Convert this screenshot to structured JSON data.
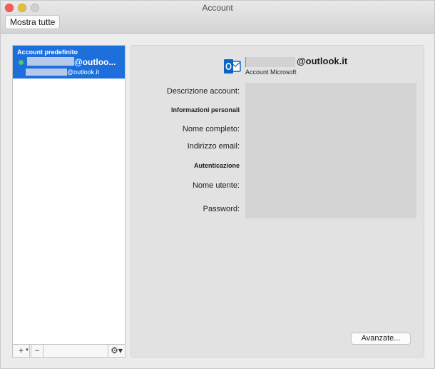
{
  "window": {
    "title": "Account"
  },
  "toolbar": {
    "show_all_label": "Mostra tutte"
  },
  "sidebar": {
    "group_label": "Account predefinito",
    "account_name": "@outloo...",
    "account_email": "@outlook.it",
    "status_color": "#4cc870",
    "selected_color": "#1d6fdc",
    "add_icon": "plus-icon",
    "remove_icon": "minus-icon",
    "actions_icon": "gear-icon",
    "add_glyph": "+",
    "add_chevron_glyph": "▾",
    "remove_glyph": "−",
    "actions_glyph": "⚙▾"
  },
  "detail": {
    "account_email": "@outlook.it",
    "account_type": "Account Microsoft",
    "fields": [
      "Descrizione account:",
      "Informazioni personali",
      "Nome completo:",
      "Indirizzo email:",
      "Autenticazione",
      "Nome utente:",
      "Password:"
    ],
    "advanced_label": "Avanzate..."
  }
}
